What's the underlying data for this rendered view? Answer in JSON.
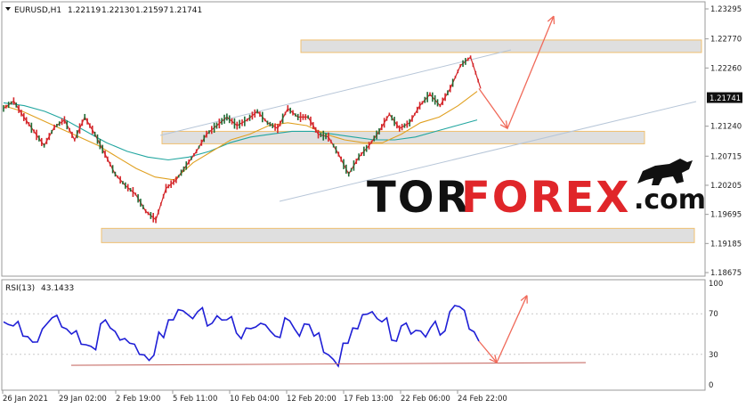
{
  "header": {
    "symbol": "EURUSD,H1",
    "open": "1.22119",
    "high": "1.22130",
    "low": "1.21597",
    "close": "1.21741"
  },
  "rsi_header": {
    "label": "RSI(13)",
    "value": "43.1433"
  },
  "watermark": {
    "tor": "TOR",
    "forex": "FOREX",
    "domain": ".com"
  },
  "colors": {
    "candle": "#d4262a",
    "candle_up": "#1f6b35",
    "ma_fast": "#e0a020",
    "ma_slow": "#22a6a0",
    "channel": "#b7c6d8",
    "zone_fill": "#d9d9d9",
    "zone_border": "#f0c070",
    "arrow": "#f06a5a",
    "rsi_line": "#1f1fd6",
    "rsi_support": "#c8706a",
    "price_tag_bg": "#111111"
  },
  "chart_data": [
    {
      "type": "line",
      "title": "EURUSD,H1",
      "x": [
        "26 Jan 2021",
        "29 Jan 02:00",
        "2 Feb 19:00",
        "5 Feb 11:00",
        "10 Feb 04:00",
        "12 Feb 20:00",
        "17 Feb 13:00",
        "22 Feb 06:00",
        "24 Feb 22:00"
      ],
      "xlabel": "",
      "ylabel": "",
      "price_ticks": [
        "1.23295",
        "1.22770",
        "1.22260",
        "1.21741",
        "1.21240",
        "1.20715",
        "1.20205",
        "1.19695",
        "1.19185",
        "1.18675"
      ],
      "ylim": [
        1.18675,
        1.23295
      ],
      "current_price": "1.21741",
      "series": [
        {
          "values": [
            1.2155,
            1.2168,
            1.214,
            1.2115,
            1.209,
            1.2122,
            1.2135,
            1.21,
            1.214,
            1.211,
            1.2075,
            1.204,
            1.202,
            1.2005,
            1.1975,
            1.196,
            1.2015,
            1.203,
            1.2055,
            1.208,
            1.211,
            1.2125,
            1.214,
            1.2125,
            1.2135,
            1.215,
            1.213,
            1.212,
            1.2155,
            1.214,
            1.214,
            1.211,
            1.2105,
            1.2075,
            1.204,
            1.207,
            1.209,
            1.2115,
            1.2145,
            1.212,
            1.213,
            1.216,
            1.218,
            1.216,
            1.219,
            1.223,
            1.2245,
            1.219
          ]
        },
        {
          "values": [
            1.216,
            1.215,
            1.2135,
            1.212,
            1.2105,
            1.209,
            1.207,
            1.205,
            1.2035,
            1.203,
            1.206,
            1.208,
            1.21,
            1.211,
            1.2125,
            1.213,
            1.2125,
            1.211,
            1.21,
            1.2095,
            1.2095,
            1.211,
            1.213,
            1.214,
            1.216,
            1.2185
          ]
        },
        {
          "values": [
            1.2165,
            1.216,
            1.215,
            1.2135,
            1.2115,
            1.2095,
            1.208,
            1.207,
            1.2065,
            1.207,
            1.208,
            1.2095,
            1.2105,
            1.211,
            1.2115,
            1.2115,
            1.211,
            1.2105,
            1.21,
            1.21,
            1.2105,
            1.2115,
            1.2125,
            1.2135
          ]
        }
      ],
      "zones": [
        {
          "from": 1.2255,
          "to": 1.2275
        },
        {
          "from": 1.2095,
          "to": 1.2115
        },
        {
          "from": 1.192,
          "to": 1.1945
        }
      ],
      "forecast": [
        1.219,
        1.212,
        1.232
      ]
    },
    {
      "type": "line",
      "title": "RSI(13) 43.1433",
      "ylim": [
        0,
        100
      ],
      "y_ticks": [
        "100",
        "70",
        "30",
        "0"
      ],
      "series": [
        {
          "values": [
            62,
            58,
            48,
            42,
            55,
            66,
            57,
            50,
            40,
            38,
            60,
            56,
            44,
            41,
            30,
            24,
            52,
            64,
            74,
            69,
            72,
            58,
            68,
            64,
            51,
            56,
            57,
            59,
            48,
            66,
            55,
            60,
            48,
            32,
            25,
            41,
            56,
            69,
            72,
            62,
            44,
            58,
            50,
            53,
            56,
            49,
            72,
            77,
            55,
            43
          ]
        }
      ],
      "support_level": 21,
      "forecast": [
        43,
        22,
        88
      ]
    }
  ]
}
